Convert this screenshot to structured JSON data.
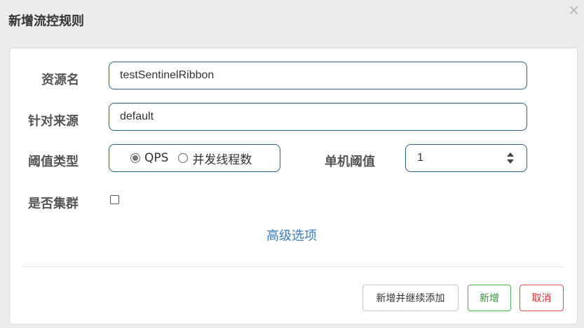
{
  "dialog": {
    "title": "新增流控规则",
    "close_icon": "×"
  },
  "form": {
    "resource_label": "资源名",
    "resource_value": "testSentinelRibbon",
    "origin_label": "针对来源",
    "origin_value": "default",
    "grade_label": "阈值类型",
    "grade_options": [
      "QPS",
      "并发线程数"
    ],
    "grade_selected": "QPS",
    "threshold_label": "单机阈值",
    "threshold_value": "1",
    "cluster_label": "是否集群",
    "cluster_checked": false,
    "advanced_link": "高级选项"
  },
  "footer": {
    "add_continue_label": "新增并继续添加",
    "add_label": "新增",
    "cancel_label": "取消"
  },
  "colors": {
    "input_border": "#2f5d7e",
    "link": "#3b7cb5",
    "success": "#4cae4c",
    "danger": "#d9534f"
  }
}
